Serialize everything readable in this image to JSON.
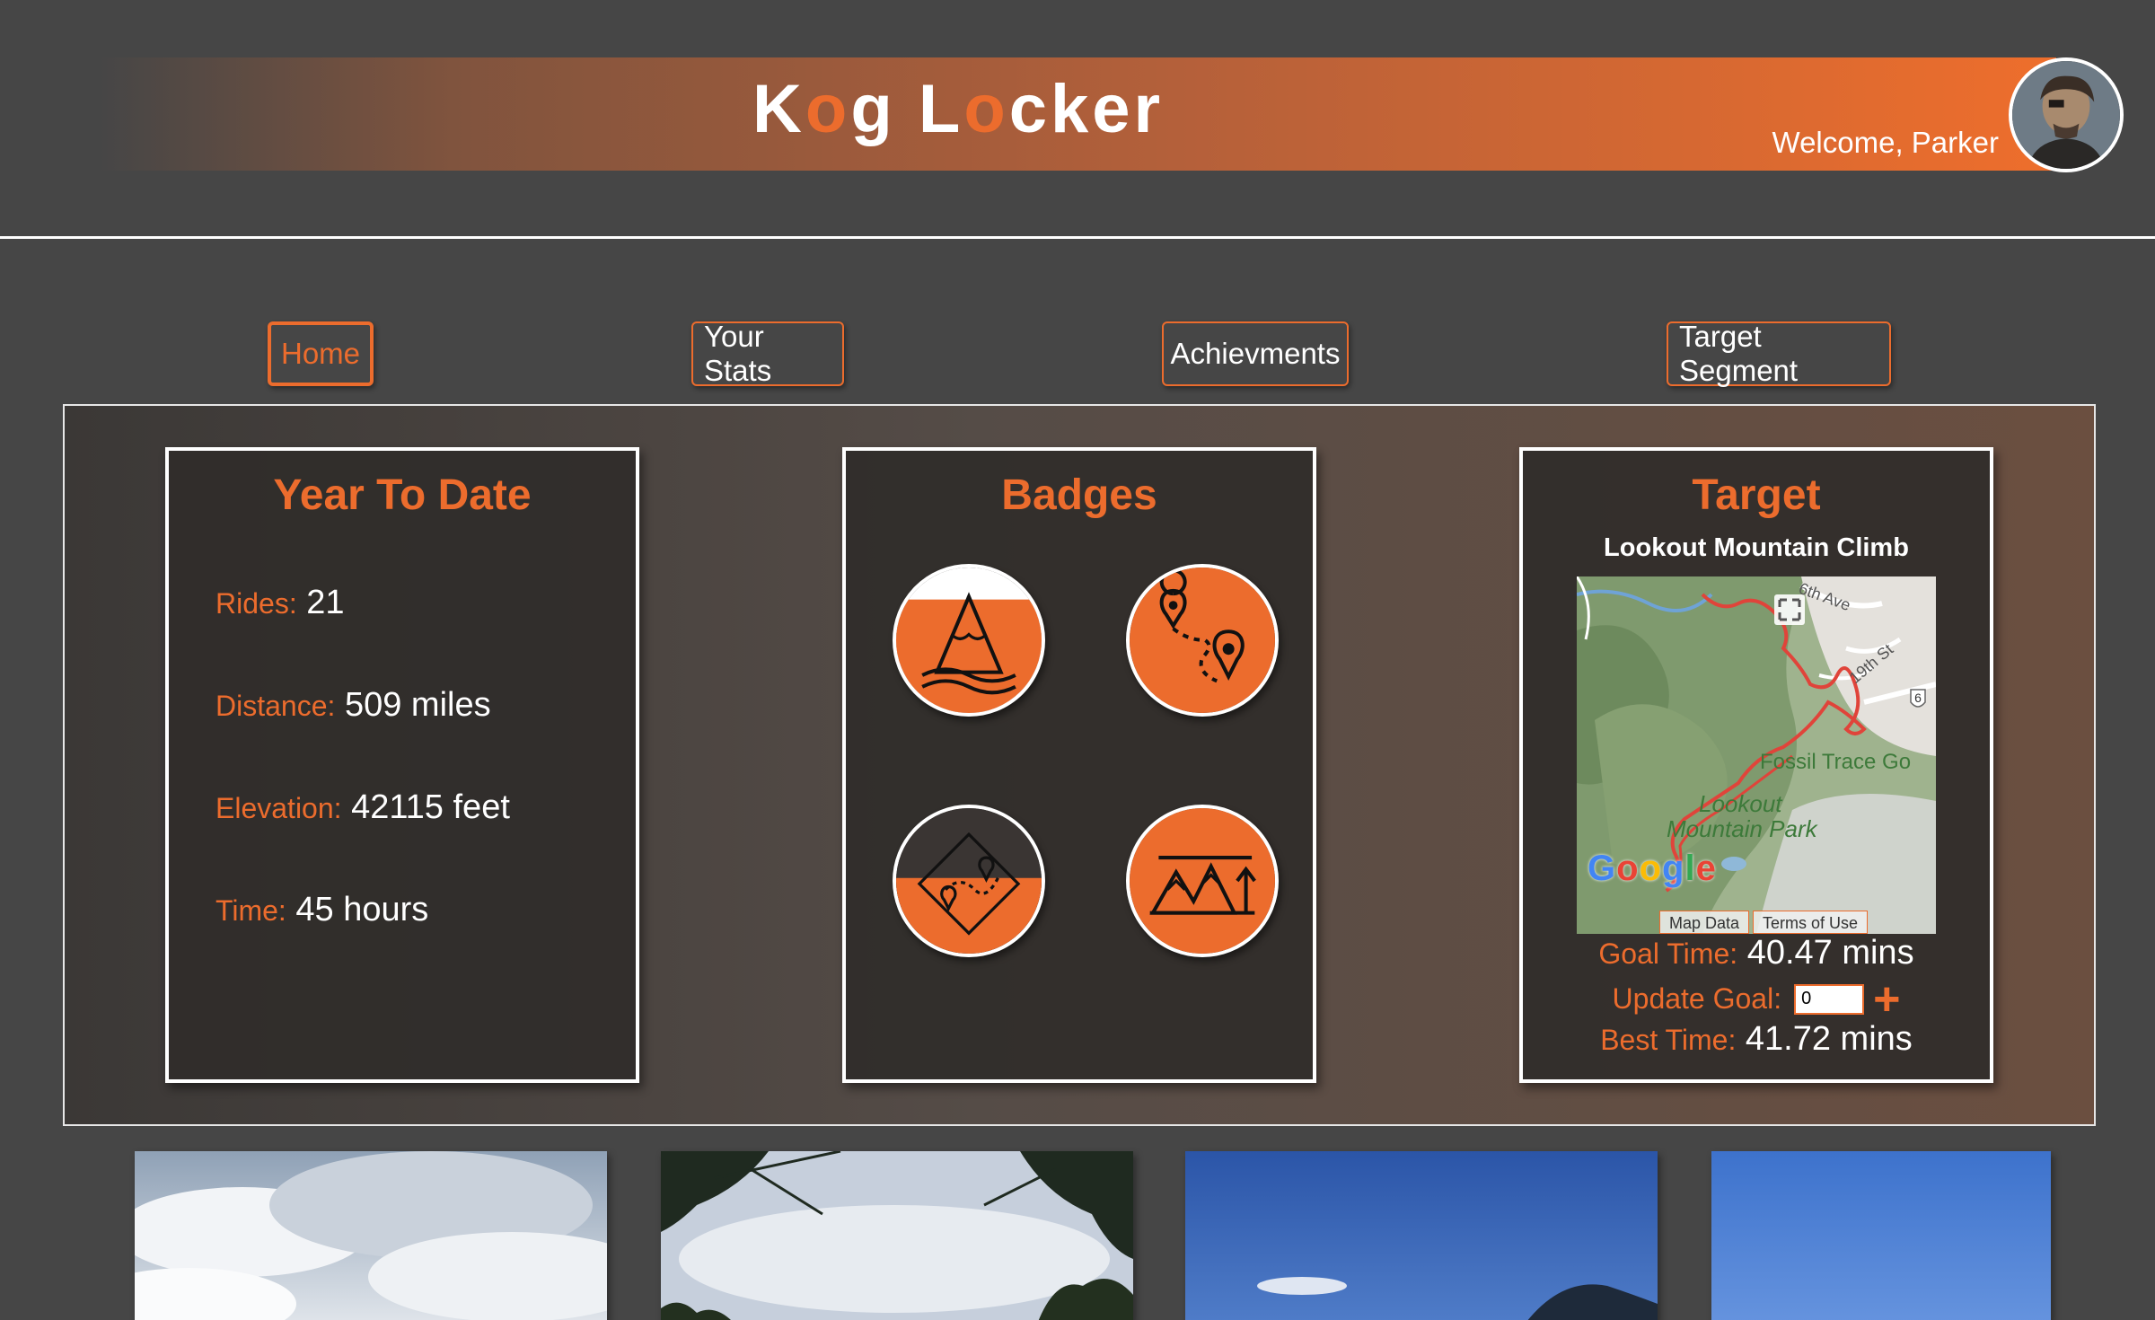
{
  "header": {
    "logo_parts": [
      "K",
      "o",
      "g",
      " L",
      "o",
      "cker"
    ],
    "welcome": "Welcome, Parker",
    "avatar_alt": "Parker"
  },
  "nav": [
    {
      "label": "Home",
      "active": true
    },
    {
      "label": "Your Stats",
      "active": false
    },
    {
      "label": "Achievments",
      "active": false
    },
    {
      "label": "Target Segment",
      "active": false
    }
  ],
  "ytd": {
    "title": "Year To Date",
    "rides_label": "Rides:",
    "rides": "21",
    "distance_label": "Distance:",
    "distance": "509 miles",
    "elevation_label": "Elevation:",
    "elevation": "42115 feet",
    "time_label": "Time:",
    "time": "45 hours"
  },
  "badges": {
    "title": "Badges",
    "items": [
      "mountain-river-icon",
      "route-pins-icon",
      "map-pins-icon",
      "summit-climb-icon"
    ]
  },
  "target": {
    "title": "Target",
    "segment": "Lookout Mountain Climb",
    "map": {
      "labels": [
        "6th Ave",
        "19th St",
        "Fossil Trace Go",
        "Lookout",
        "Mountain Park"
      ],
      "shield": "6",
      "google": "Google",
      "map_data": "Map Data",
      "terms": "Terms of Use"
    },
    "goal_label": "Goal Time:",
    "goal": "40.47 mins",
    "update_label": "Update Goal:",
    "update_value": "0",
    "best_label": "Best Time:",
    "best": "41.72 mins"
  },
  "colors": {
    "accent": "#ec6c2d",
    "background": "#464646",
    "card": "#302c2a"
  }
}
